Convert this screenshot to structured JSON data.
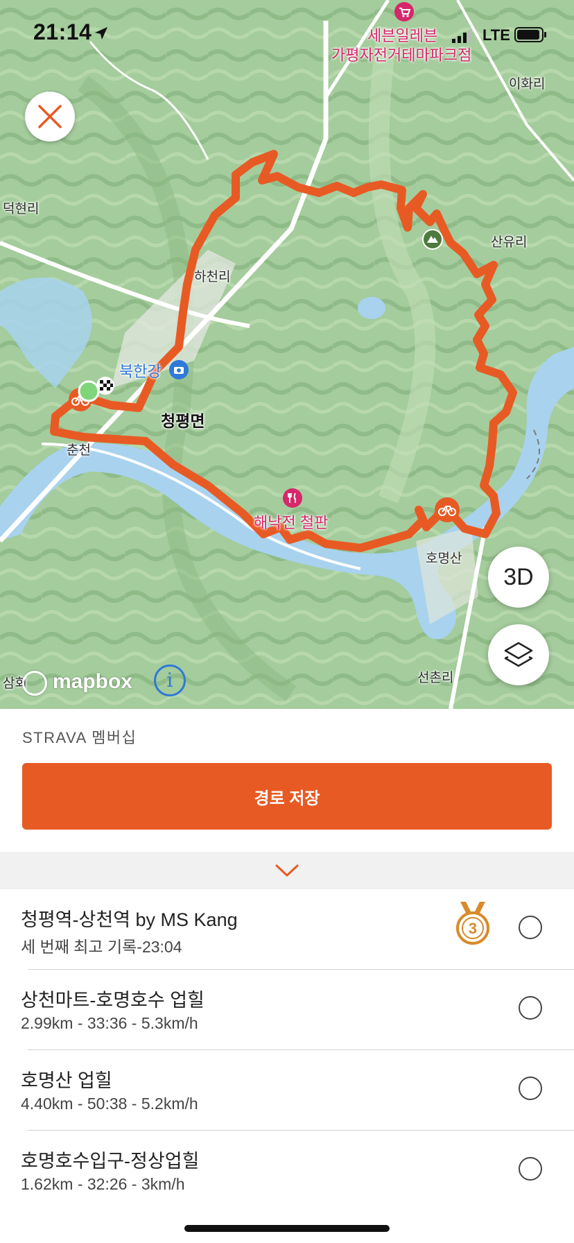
{
  "status_bar": {
    "time": "21:14",
    "network": "LTE",
    "icons": [
      "location-arrow-icon",
      "signal-icon",
      "battery-icon"
    ]
  },
  "map": {
    "labels": {
      "seven_eleven_line1": "세븐일레븐",
      "seven_eleven_line2": "가평자전거테마파크점",
      "ihwa_ri": "이화리",
      "deokhyeon_ri": "덕현리",
      "sanyu_ri": "산유리",
      "hacheon_ri": "하천리",
      "bukhangang": "북한강",
      "cheongpyeong_myeon": "청평면",
      "chuncheon": "춘천",
      "restaurant": "해낙전 철판",
      "homyeongsan": "호명산",
      "seonchon_ri": "선촌리",
      "samhoe": "삼회"
    },
    "attribution": "mapbox",
    "info_symbol": "i",
    "btn_3d": "3D",
    "route_color": "#e85a24",
    "icons": [
      "close-icon",
      "layers-icon",
      "info-icon",
      "shop-icon",
      "camera-icon",
      "restaurant-icon",
      "peak-icon",
      "bike-icon",
      "finish-flag-icon",
      "start-marker-icon"
    ]
  },
  "membership_label": "STRAVA 멤버십",
  "save_route_label": "경로 저장",
  "accent_color": "#e85a24",
  "segments": [
    {
      "name": "청평역-상천역 by MS Kang",
      "detail": "세 번째 최고 기록-23:04",
      "medal": "3"
    },
    {
      "name": "상천마트-호명호수 업힐",
      "detail": "2.99km - 33:36 - 5.3km/h"
    },
    {
      "name": "호명산 업힐",
      "detail": "4.40km - 50:38 - 5.2km/h"
    },
    {
      "name": "호명호수입구-정상업힐",
      "detail": "1.62km - 32:26 - 3km/h"
    }
  ]
}
